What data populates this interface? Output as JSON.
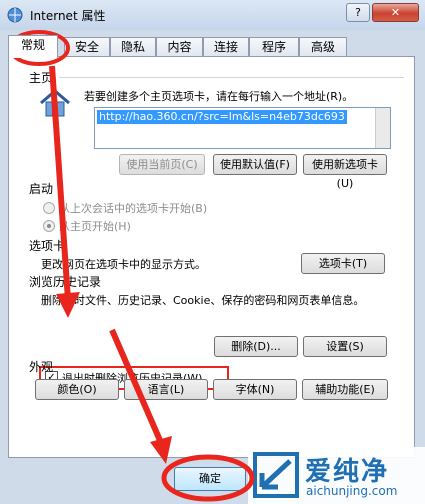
{
  "window": {
    "title": "Internet 属性",
    "help": "?",
    "close": "✕"
  },
  "tabs": [
    "常规",
    "安全",
    "隐私",
    "内容",
    "连接",
    "程序",
    "高级"
  ],
  "home": {
    "label": "主页",
    "hint": "若要创建多个主页选项卡，请在每行输入一个地址(R)。",
    "url": "http://hao.360.cn/?src=lm&ls=n4eb73dc693",
    "btn_current": "使用当前页(C)",
    "btn_default": "使用默认值(F)",
    "btn_new_tab": "使用新选项卡(U)"
  },
  "startup": {
    "label": "启动",
    "option1": "从上次会话中的选项卡开始(B)",
    "option2": "从主页开始(H)"
  },
  "tabs_section": {
    "label": "选项卡",
    "hint": "更改网页在选项卡中的显示方式。",
    "btn": "选项卡(T)"
  },
  "history": {
    "label": "浏览历史记录",
    "hint": "删除临时文件、历史记录、Cookie、保存的密码和网页表单信息。",
    "checkbox": "退出时删除浏览历史记录(W)",
    "btn_delete": "删除(D)...",
    "btn_settings": "设置(S)"
  },
  "appearance": {
    "label": "外观",
    "btn_colors": "颜色(O)",
    "btn_languages": "语言(L)",
    "btn_fonts": "字体(N)",
    "btn_accessibility": "辅助功能(E)"
  },
  "footer": {
    "ok": "确定"
  },
  "watermark": {
    "text": "爱纯净",
    "url": "aichunjing.com"
  },
  "annotation_color": "#e8261e"
}
